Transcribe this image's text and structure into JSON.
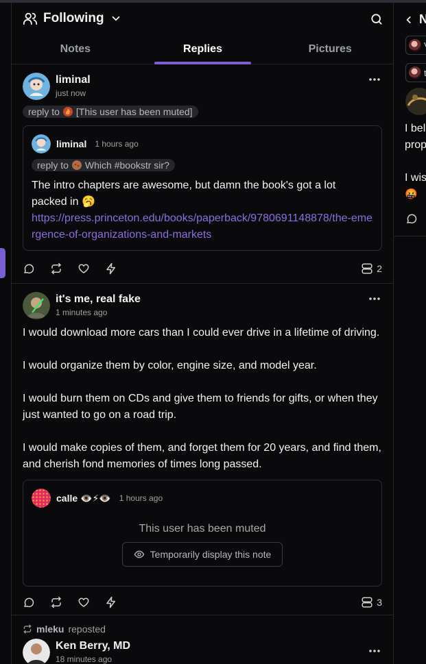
{
  "header": {
    "title": "Following",
    "tabs": [
      {
        "label": "Notes",
        "active": false
      },
      {
        "label": "Replies",
        "active": true
      },
      {
        "label": "Pictures",
        "active": false
      }
    ],
    "accent_color": "#7b5fd0"
  },
  "notes": [
    {
      "author": "liminal",
      "time": "just now",
      "reply_to": "[This user has been muted]",
      "quote": {
        "author": "liminal",
        "time": "1 hours ago",
        "reply_to": "Which #bookstr sir?",
        "text": "The intro chapters are awesome, but damn the book's got a lot packed in 🥱",
        "link": "https://press.princeton.edu/books/paperback/9780691148878/the-emergence-of-organizations-and-markets"
      },
      "reply_count": "2"
    },
    {
      "author": "it's me, real fake",
      "time": "1 minutes ago",
      "paragraphs": [
        "I would download more cars than I could ever drive in a lifetime of driving.",
        "I would organize them by color, engine size, and model year.",
        "I would burn them on CDs and give them to friends for gifts, or when they just wanted to go on a road trip.",
        "I would make copies of them, and forget them for 20 years, and find them, and cherish fond memories of times long passed."
      ],
      "quote": {
        "author": "calle 👁️⚡👁️",
        "time": "1 hours ago",
        "muted_text": "This user has been muted",
        "display_button": "Temporarily display this note"
      },
      "reply_count": "3"
    },
    {
      "reposted_by": "mleku",
      "reposted_label": "reposted",
      "author": "Ken Berry, MD",
      "time": "18 minutes ago"
    }
  ],
  "right_panel": {
    "header_fragment": "N",
    "pill_1": "V",
    "pill_2": "tl",
    "text_1": "I bel",
    "text_2": "prop",
    "text_3": "I wis",
    "emoji": "🤬"
  }
}
